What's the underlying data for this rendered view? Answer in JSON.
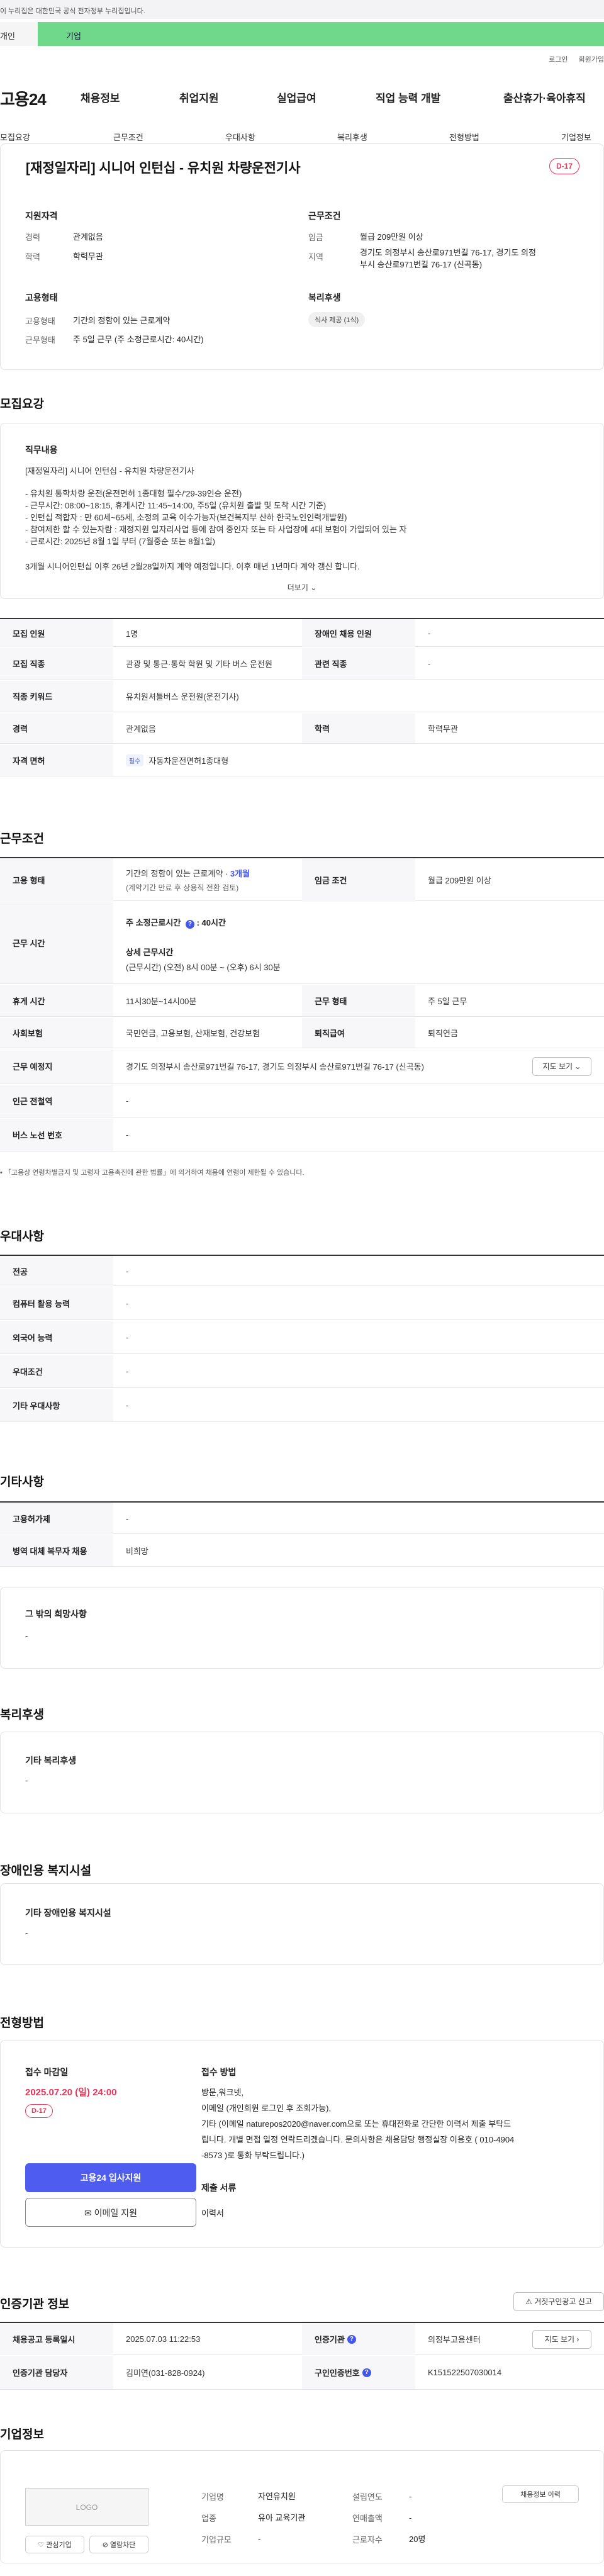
{
  "gov_banner": "이 누리집은 대한민국 공식 전자정부 누리집입니다.",
  "top_tabs": {
    "person": "개인",
    "business": "기업"
  },
  "util": {
    "login": "로그인",
    "join": "회원가입"
  },
  "gnb": {
    "logo": "고용24",
    "menus": [
      "채용정보",
      "취업지원",
      "실업급여",
      "직업 능력 개발",
      "출산휴가·육아휴직"
    ]
  },
  "subnav": [
    "모집요강",
    "근무조건",
    "우대사항",
    "복리후생",
    "전형방법",
    "기업정보"
  ],
  "job": {
    "title": "[재정일자리] 시니어 인턴십 - 유치원 차량운전기사",
    "dday": "D-17",
    "qualification_h": "지원자격",
    "career_k": "경력",
    "career_v": "관계없음",
    "edu_k": "학력",
    "edu_v": "학력무관",
    "workcond_h": "근무조건",
    "wage_k": "임금",
    "wage_v": "월급 209만원 이상",
    "region_k": "지역",
    "region_v1": "경기도 의정부시 송산로971번길 76-17, 경기도 의정",
    "region_v2": "부시 송산로971번길 76-17 (신곡동)",
    "employ_h": "고용형태",
    "etype_k": "고용형태",
    "etype_v": "기간의 정함이 있는 근로계약",
    "wform_k": "근무형태",
    "wform_v": "주 5일 근무 (주 소정근로시간: 40시간)",
    "welfare_h": "복리후생",
    "welfare_pill": "식사 제공 (1식)"
  },
  "recruit": {
    "heading": "모집요강",
    "desc_h": "직무내용",
    "lines": [
      "[재정일자리] 시니어 인턴십 - 유치원 차량운전기사",
      "- 유치원 통학차량 운전(운전면허 1종대형 필수/'29-39인승 운전)",
      "- 근무시간: 08:00~18:15, 휴게시간 11:45~14:00, 주5일 (유치원 출발 및 도착 시간 기준)",
      "- 인턴십 적합자 :  만 60세~65세, 소정의 교육 이수가능자(보건복지부 산하 한국노인인력개발원)",
      "- 참여제한 할 수 있는자람 : 재정지원 일자리사업 등에 참여 중인자 또는 타 사업장에 4대 보험이 가입되어 있는 자",
      "- 근로시간: 2025년 8월 1일 부터 (7월중순 또는 8월1일)",
      "3개월 시니어인턴십 이후  26년 2월28일까지 계약 예정입니다. 이후 매년 1년마다 계약 갱신 합니다."
    ],
    "more": "더보기",
    "rows": [
      {
        "k1": "모집 인원",
        "v1": "1명",
        "k2": "장애인 채용 인원",
        "v2": "-"
      },
      {
        "k1": "모집 직종",
        "v1": "관광 및 통근·통학 학원 및 기타 버스 운전원",
        "k2": "관련 직종",
        "v2": "-"
      },
      {
        "k1": "직종 키워드",
        "v1": "유치원셔틀버스 운전원(운전기사)"
      },
      {
        "k1": "경력",
        "v1": "관계없음",
        "k2": "학력",
        "v2": "학력무관"
      },
      {
        "k1": "자격 면허",
        "tag": "필수",
        "v1": "자동차운전면허1종대형"
      }
    ]
  },
  "workcond": {
    "heading": "근무조건",
    "etype_k": "고용 형태",
    "etype_v": "기간의 정함이 있는 근로계약 · ",
    "etype_blue": "3개월",
    "etype_sub": "(계약기간 만료 후 상용직 전환 검토)",
    "wage_k": "임금 조건",
    "wage_v": "월급 209만원 이상",
    "hours_k": "근무 시간",
    "hours_main": "주 소정근로시간",
    "hours_main_v": ": 40시간",
    "hours_detail_h": "상세 근무시간",
    "hours_detail_v": "(근무시간) (오전) 8시 00분 ~ (오후) 6시 30분",
    "break_k": "휴게 시간",
    "break_v": "11시30분~14시00분",
    "wform_k": "근무 형태",
    "wform_v": "주 5일 근무",
    "ins_k": "사회보험",
    "ins_v": "국민연금, 고용보험, 산재보험, 건강보험",
    "retire_k": "퇴직급여",
    "retire_v": "퇴직연금",
    "place_k": "근무 예정지",
    "place_v": "경기도 의정부시 송산로971번길 76-17, 경기도 의정부시 송산로971번길 76-17 (신곡동)",
    "map_btn": "지도 보기",
    "subway_k": "인근 전철역",
    "subway_v": "-",
    "bus_k": "버스 노선 번호",
    "bus_v": "-",
    "note": "「고용상 연령차별금지 및 고령자 고용촉진에 관한 법률」에 의거하여 채용에 연령이 제한될 수 있습니다."
  },
  "preference": {
    "heading": "우대사항",
    "rows": [
      {
        "k": "전공",
        "v": "-"
      },
      {
        "k": "컴퓨터 활용 능력",
        "v": "-"
      },
      {
        "k": "외국어 능력",
        "v": "-"
      },
      {
        "k": "우대조건",
        "v": "-"
      },
      {
        "k": "기타 우대사항",
        "v": "-"
      }
    ]
  },
  "etc": {
    "heading": "기타사항",
    "rows": [
      {
        "k": "고용허가제",
        "v": "-"
      },
      {
        "k": "병역 대체 복무자 채용",
        "v": "비희망"
      }
    ],
    "other_h": "그 밖의 희망사항",
    "other_v": "-"
  },
  "welfare": {
    "heading": "복리후생",
    "sub_h": "기타 복리후생",
    "sub_v": "-"
  },
  "disabled": {
    "heading": "장애인용 복지시설",
    "sub_h": "기타 장애인용 복지시설",
    "sub_v": "-"
  },
  "selection": {
    "heading": "전형방법",
    "deadline_h": "접수 마감일",
    "deadline_v": "2025.07.20 (일) 24:00",
    "dday": "D-17",
    "method_h": "접수 방법",
    "method_lines": [
      "방문,워크넷,",
      "이메일 (개인회원 로그인 후 조회가능),",
      "기타 (이메일 naturepos2020@naver.com으로 또는 휴대전화로 간단한 이력서 제출 부탁드",
      "립니다. 개별 면접 일정 연락드리겠습니다.  문의사항은 채용담당 행정실장 이용호 ( 010-4904",
      "-8573 )로 통화 부탁드립니다.)"
    ],
    "docs_h": "제출 서류",
    "docs_v": "이력서",
    "apply_btn": "고용24 입사지원",
    "email_btn": "이메일 지원"
  },
  "certify": {
    "heading": "인증기관 정보",
    "report_btn": "거짓구인광고 신고",
    "reg_k": "채용공고 등록일시",
    "reg_v": "2025.07.03 11:22:53",
    "agency_k": "인증기관",
    "agency_v": "의정부고용센터",
    "map_btn": "지도 보기",
    "mgr_k": "인증기관 담당자",
    "mgr_v": "김미연(031-828-0924)",
    "num_k": "구인인증번호",
    "num_v": "K151522507030014"
  },
  "company": {
    "heading": "기업정보",
    "logo": "LOGO",
    "fav_btn": "관심기업",
    "block_btn": "열람차단",
    "name_k": "기업명",
    "name_v": "자연유치원",
    "est_k": "설립연도",
    "est_v": "-",
    "ind_k": "업종",
    "ind_v": "유아 교육기관",
    "sales_k": "연매출액",
    "sales_v": "-",
    "size_k": "기업규모",
    "size_v": "-",
    "emp_k": "근로자수",
    "emp_v": "20명",
    "list_btn": "채용정보 이력"
  }
}
